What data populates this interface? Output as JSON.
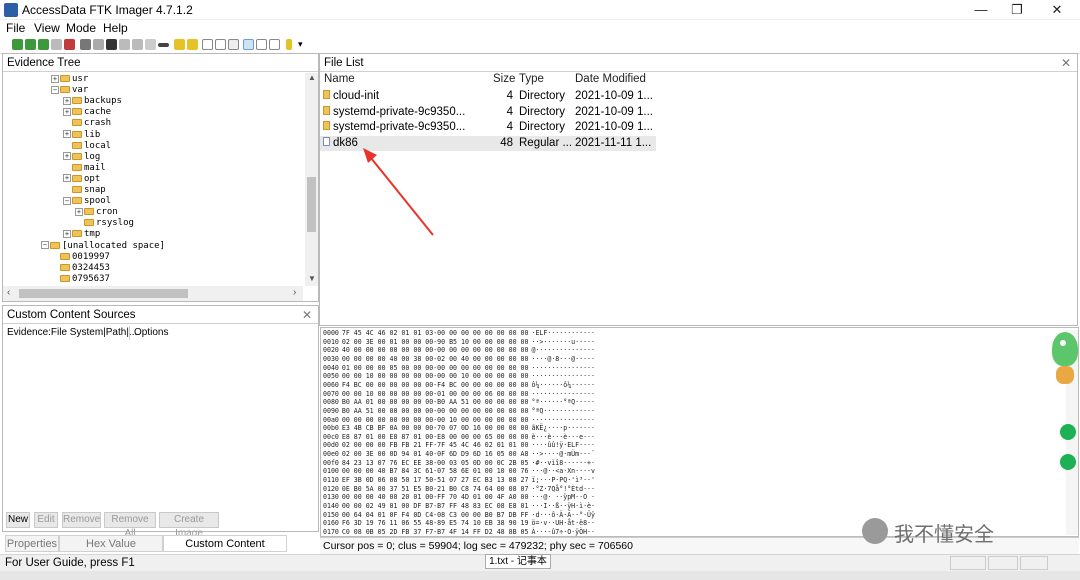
{
  "window": {
    "title": "AccessData FTK Imager 4.7.1.2",
    "minimize": "—",
    "maximize": "❐",
    "close": "✕"
  },
  "menu": [
    "File",
    "View",
    "Mode",
    "Help"
  ],
  "evidence_tree": {
    "title": "Evidence Tree",
    "items": [
      {
        "label": "usr",
        "indent": 1,
        "expand": "+",
        "kind": "folder"
      },
      {
        "label": "var",
        "indent": 1,
        "expand": "−",
        "kind": "folder"
      },
      {
        "label": "backups",
        "indent": 2,
        "expand": "+",
        "kind": "folder"
      },
      {
        "label": "cache",
        "indent": 2,
        "expand": "+",
        "kind": "folder"
      },
      {
        "label": "crash",
        "indent": 2,
        "expand": "",
        "kind": "folder"
      },
      {
        "label": "lib",
        "indent": 2,
        "expand": "+",
        "kind": "folder"
      },
      {
        "label": "local",
        "indent": 2,
        "expand": "",
        "kind": "folder"
      },
      {
        "label": "log",
        "indent": 2,
        "expand": "+",
        "kind": "folder"
      },
      {
        "label": "mail",
        "indent": 2,
        "expand": "",
        "kind": "folder"
      },
      {
        "label": "opt",
        "indent": 2,
        "expand": "+",
        "kind": "folder"
      },
      {
        "label": "snap",
        "indent": 2,
        "expand": "",
        "kind": "folder"
      },
      {
        "label": "spool",
        "indent": 2,
        "expand": "−",
        "kind": "folder"
      },
      {
        "label": "cron",
        "indent": 3,
        "expand": "+",
        "kind": "folder"
      },
      {
        "label": "rsyslog",
        "indent": 3,
        "expand": "",
        "kind": "folder"
      },
      {
        "label": "tmp",
        "indent": 2,
        "expand": "+",
        "kind": "folder"
      },
      {
        "label": "[unallocated space]",
        "indent": 0,
        "expand": "−",
        "kind": "folder"
      },
      {
        "label": "0019997",
        "indent": 1,
        "expand": "",
        "kind": "folder"
      },
      {
        "label": "0324453",
        "indent": 1,
        "expand": "",
        "kind": "folder"
      },
      {
        "label": "0795637",
        "indent": 1,
        "expand": "",
        "kind": "folder"
      }
    ]
  },
  "file_list": {
    "title": "File List",
    "columns": {
      "name": "Name",
      "size": "Size",
      "type": "Type",
      "date": "Date Modified"
    },
    "rows": [
      {
        "name": "cloud-init",
        "size": "4",
        "type": "Directory",
        "date": "2021-10-09 1..."
      },
      {
        "name": "systemd-private-9c9350...",
        "size": "4",
        "type": "Directory",
        "date": "2021-10-09 1..."
      },
      {
        "name": "systemd-private-9c9350...",
        "size": "4",
        "type": "Directory",
        "date": "2021-10-09 1..."
      },
      {
        "name": "dk86",
        "size": "48",
        "type": "Regular ...",
        "date": "2021-11-11 1..."
      }
    ]
  },
  "custom_content": {
    "title": "Custom Content Sources",
    "col1": "Evidence:File System|Path|...",
    "col2": "Options"
  },
  "buttons": [
    "New",
    "Edit",
    "Remove",
    "Remove All",
    "Create Image"
  ],
  "tabs": [
    "Properties",
    "Hex Value Interpreter",
    "Custom Content Sources"
  ],
  "hex": [
    {
      "off": "0000",
      "bytes": "7F 45 4C 46 02 01 01 03-00 00 00 00 00 00 00 00",
      "ascii": "·ELF············"
    },
    {
      "off": "0010",
      "bytes": "02 00 3E 00 01 00 00 00-90 B5 10 00 00 00 00 00",
      "ascii": "··>·······u·····"
    },
    {
      "off": "0020",
      "bytes": "40 00 00 00 00 00 00 00-00 00 00 00 00 00 00 00",
      "ascii": "@···············"
    },
    {
      "off": "0030",
      "bytes": "00 00 00 00 40 00 38 00-02 00 40 00 00 00 00 00",
      "ascii": "····@·8···@·····"
    },
    {
      "off": "0040",
      "bytes": "01 00 00 00 05 00 00 00-00 00 00 00 00 00 00 00",
      "ascii": "················"
    },
    {
      "off": "0050",
      "bytes": "00 00 10 00 00 00 00 00-00 00 10 00 00 00 00 00",
      "ascii": "················"
    },
    {
      "off": "0060",
      "bytes": "F4 BC 00 00 00 00 00 00-F4 BC 00 00 00 00 00 00",
      "ascii": "ô¼······ô¼······"
    },
    {
      "off": "0070",
      "bytes": "00 00 10 00 00 00 00 00-01 00 00 00 06 00 00 00",
      "ascii": "················"
    },
    {
      "off": "0080",
      "bytes": "B0 AA 01 00 00 00 00 00-B0 AA 51 00 00 00 00 00",
      "ascii": "°ª······°ªQ·····"
    },
    {
      "off": "0090",
      "bytes": "B0 AA 51 00 00 00 00 00-00 00 00 00 00 00 00 00",
      "ascii": "°ªQ·············"
    },
    {
      "off": "00a0",
      "bytes": "00 00 00 00 00 00 00 00-00 10 00 00 00 00 00 00",
      "ascii": "················"
    },
    {
      "off": "00b0",
      "bytes": "E3 4B CB BF 0A 00 00 00-70 07 0D 16 00 00 00 00",
      "ascii": "ãKË¿····p·······"
    },
    {
      "off": "00c0",
      "bytes": "E8 87 01 00 E8 87 01 00-E8 00 00 00 65 00 00 00",
      "ascii": "è···è···è···e···"
    },
    {
      "off": "00d0",
      "bytes": "02 00 00 00 FB FB 21 FF-7F 45 4C 46 02 01 01 00",
      "ascii": "····ûû!ÿ·ELF····"
    },
    {
      "off": "00e0",
      "bytes": "02 00 3E 00 0D 94 01 40-0F 6D D9 6D 16 05 00 A8",
      "ascii": "··>····@·mÙm···¨"
    },
    {
      "off": "00f0",
      "bytes": "84 23 13 07 76 EC EE 38-00 03 05 0D 00 0C 2B 05",
      "ascii": "·#··vìî8······+·"
    },
    {
      "off": "0100",
      "bytes": "00 00 00 40 B7 84 3C 61-07 58 6E 01 00 10 00 76",
      "ascii": "···@··<a·Xn····v"
    },
    {
      "off": "0110",
      "bytes": "EF 3B 0D 06 08 50 17 50-51 07 27 EC B3 13 08 27",
      "ascii": "ï;···P·PQ·'ì³··'"
    },
    {
      "off": "0120",
      "bytes": "0E B0 5A 00 37 51 E5 B0-21 B0 C8 74 64 00 08 07",
      "ascii": "·°Z·7Qå°!°Ètd···"
    },
    {
      "off": "0130",
      "bytes": "00 00 00 40 00 20 01 00-FF 70 4D 01 00 4F A0 00",
      "ascii": "···@· ··ÿpM··O ·"
    },
    {
      "off": "0140",
      "bytes": "00 00 02 49 01 00 DF B7-B7 FF 48 83 EC 08 E8 01",
      "ascii": "···I··ß··ÿH·ì·è·"
    },
    {
      "off": "0150",
      "bytes": "00 64 04 01 0F F4 0D C4-08 C3 00 00 B0 B7 DB FF",
      "ascii": "·d···ô·Ä·Ã··°·Ûÿ"
    },
    {
      "off": "0160",
      "bytes": "F6 3D 19 76 11 06 55 48-89 E5 74 10 EB 38 90 19",
      "ascii": "ö=·v··UH·åt·ë8··"
    },
    {
      "off": "0170",
      "bytes": "C0 08 0B 05 2D FB 37 F7-B7 4F 14 FF D2 48 8B 05",
      "ascii": "À···-û7÷·O·ÿÒH··"
    }
  ],
  "status": {
    "cursor": "Cursor pos = 0; clus = 59904; log sec = 479232; phy sec = 706560",
    "help": "For User Guide, press F1",
    "notepad": "1.txt - 记事本"
  },
  "watermark": "我不懂安全"
}
